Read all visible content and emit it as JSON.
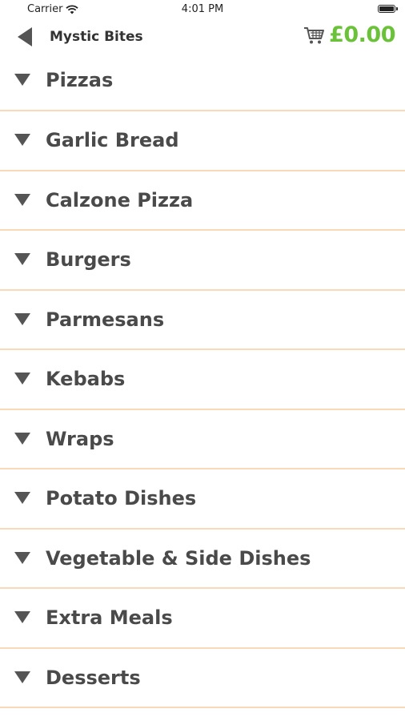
{
  "status_bar": {
    "carrier": "Carrier",
    "time": "4:01 PM",
    "icons": [
      "wifi-icon",
      "battery-icon"
    ]
  },
  "header": {
    "title": "Mystic Bites",
    "back_icon": "back-arrow-icon",
    "cart_icon": "shopping-cart-icon",
    "cart_total": "£0.00",
    "cart_total_color": "#6cc13a"
  },
  "categories": [
    {
      "label": "Pizzas"
    },
    {
      "label": "Garlic Bread"
    },
    {
      "label": "Calzone Pizza"
    },
    {
      "label": "Burgers"
    },
    {
      "label": "Parmesans"
    },
    {
      "label": "Kebabs"
    },
    {
      "label": "Wraps"
    },
    {
      "label": "Potato Dishes"
    },
    {
      "label": "Vegetable & Side Dishes"
    },
    {
      "label": "Extra Meals"
    },
    {
      "label": "Desserts"
    }
  ],
  "colors": {
    "divider": "#f8d9b8",
    "text": "#4a4a4a",
    "accent": "#6cc13a"
  }
}
